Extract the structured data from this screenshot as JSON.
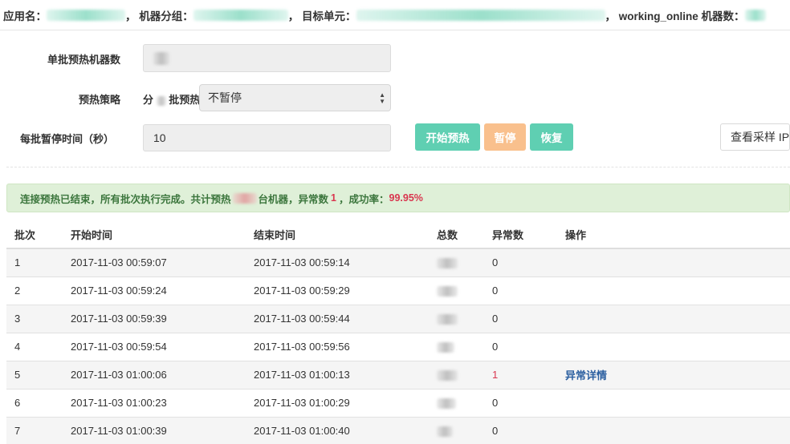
{
  "topbar": {
    "app_label": "应用名：",
    "group_label": "，  机器分组：",
    "unit_label": "，  目标单元：",
    "online_label": "，  working_online 机器数："
  },
  "form": {
    "batch_label": "单批预热机器数",
    "strategy_label": "预热策略",
    "strategy_prefix": "分",
    "strategy_suffix": "批预热",
    "strategy_value": "不暂停",
    "pause_label": "每批暂停时间（秒）",
    "pause_value": "10"
  },
  "buttons": {
    "start": "开始预热",
    "pause": "暂停",
    "resume": "恢复",
    "view_ip": "查看采样 IP"
  },
  "alert": {
    "text1": "连接预热已结束，所有批次执行完成。共计预热",
    "text2": "台机器，异常数",
    "error_count": "1",
    "text3": "，成功率：",
    "success_rate": "99.95%"
  },
  "table": {
    "headers": [
      "批次",
      "开始时间",
      "结束时间",
      "总数",
      "异常数",
      "操作"
    ],
    "rows": [
      {
        "batch": "1",
        "start": "2017-11-03 00:59:07",
        "end": "2017-11-03 00:59:14",
        "errors": "0",
        "action": ""
      },
      {
        "batch": "2",
        "start": "2017-11-03 00:59:24",
        "end": "2017-11-03 00:59:29",
        "errors": "0",
        "action": ""
      },
      {
        "batch": "3",
        "start": "2017-11-03 00:59:39",
        "end": "2017-11-03 00:59:44",
        "errors": "0",
        "action": ""
      },
      {
        "batch": "4",
        "start": "2017-11-03 00:59:54",
        "end": "2017-11-03 00:59:56",
        "errors": "0",
        "action": ""
      },
      {
        "batch": "5",
        "start": "2017-11-03 01:00:06",
        "end": "2017-11-03 01:00:13",
        "errors": "1",
        "action": "异常详情"
      },
      {
        "batch": "6",
        "start": "2017-11-03 01:00:23",
        "end": "2017-11-03 01:00:29",
        "errors": "0",
        "action": ""
      },
      {
        "batch": "7",
        "start": "2017-11-03 01:00:39",
        "end": "2017-11-03 01:00:40",
        "errors": "0",
        "action": ""
      }
    ]
  }
}
